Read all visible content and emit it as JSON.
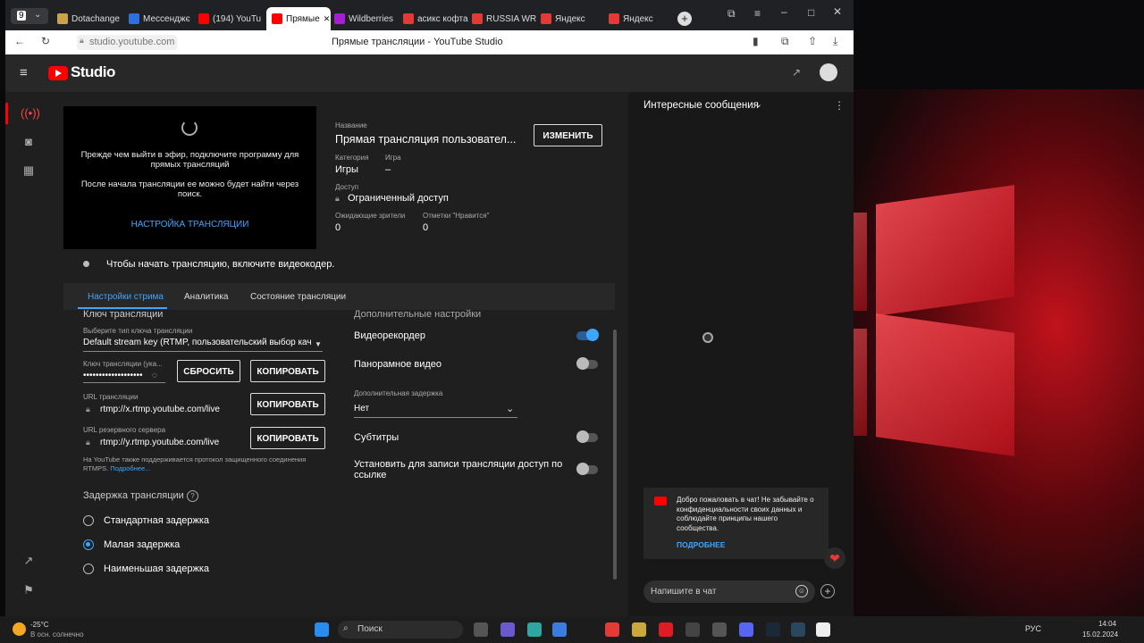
{
  "browser": {
    "tab_count": "9",
    "tabs": [
      {
        "label": "Dotachange",
        "color": "#caa24a"
      },
      {
        "label": "Мессенджє",
        "color": "#2f6fe0"
      },
      {
        "label": "(194) YouTu",
        "color": "#ff0000"
      },
      {
        "label": "Прямые",
        "color": "#ff0000"
      },
      {
        "label": "Wildberries",
        "color": "#a31fd1"
      },
      {
        "label": "асикс кофта",
        "color": "#e53935"
      },
      {
        "label": "RUSSIA WR",
        "color": "#e53935"
      },
      {
        "label": "Яндекс",
        "color": "#e53935"
      },
      {
        "label": "Яндекс",
        "color": "#e53935"
      }
    ],
    "url": "studio.youtube.com",
    "page_title": "Прямые трансляции - YouTube Studio"
  },
  "header": {
    "logo_text": "Studio"
  },
  "stream": {
    "preview_text_1": "Прежде чем выйти в эфир, подключите программу для прямых трансляций",
    "preview_text_2": "После начала трансляции ее можно будет найти через поиск.",
    "setup_link": "НАСТРОЙКА ТРАНСЛЯЦИИ",
    "title_label": "Название",
    "title_value": "Прямая трансляция пользовател...",
    "edit_button": "ИЗМЕНИТЬ",
    "category_label": "Категория",
    "category_value": "Игры",
    "game_label": "Игра",
    "game_value": "–",
    "access_label": "Доступ",
    "access_value": "Ограниченный доступ",
    "waiting_label": "Ожидающие зрители",
    "waiting_value": "0",
    "likes_label": "Отметки \"Нравится\"",
    "likes_value": "0",
    "status_text": "Чтобы начать трансляцию, включите видеокодер."
  },
  "tabs": [
    "Настройки стрима",
    "Аналитика",
    "Состояние трансляции"
  ],
  "settings": {
    "key_heading": "Ключ трансляции",
    "key_type_label": "Выберите тип ключа трансляции",
    "key_type_value": "Default stream key (RTMP, пользовательский выбор кач",
    "key_label": "Ключ трансляции (ука...",
    "key_value": "•••••••••••••••••••",
    "reset_button": "СБРОСИТЬ",
    "copy_button": "КОПИРОВАТЬ",
    "url_label": "URL трансляции",
    "url_value": "rtmp://x.rtmp.youtube.com/live",
    "backup_label": "URL резервного сервера",
    "backup_value": "rtmp://y.rtmp.youtube.com/live",
    "rtmps_note": "На YouTube также поддерживается протокол защищенного соединения RTMPS.",
    "more_link": "Подробнее...",
    "latency_heading": "Задержка трансляции",
    "latency_options": [
      "Стандартная задержка",
      "Малая задержка",
      "Наименьшая задержка"
    ],
    "latency_selected": "Малая задержка",
    "extra_heading": "Дополнительные настройки",
    "dvr_label": "Видеорекордер",
    "dvr_on": true,
    "pano_label": "Панорамное видео",
    "pano_on": false,
    "extra_delay_label": "Дополнительная задержка",
    "extra_delay_value": "Нет",
    "subs_label": "Субтитры",
    "subs_on": false,
    "link_access_label": "Установить для записи трансляции доступ по ссылке",
    "link_access_on": false
  },
  "chat": {
    "mode": "Интересные сообщения",
    "notice_text": "Добро пожаловать в чат! Не забывайте о конфиденциальности своих данных и соблюдайте принципы нашего сообщества.",
    "notice_link": "ПОДРОБНЕЕ",
    "input_placeholder": "Напишите в чат"
  },
  "taskbar": {
    "temp": "-25°C",
    "weather": "В осн. солнечно",
    "search": "Поиск",
    "lang": "РУС",
    "time": "14:04",
    "date": "15.02.2024"
  }
}
